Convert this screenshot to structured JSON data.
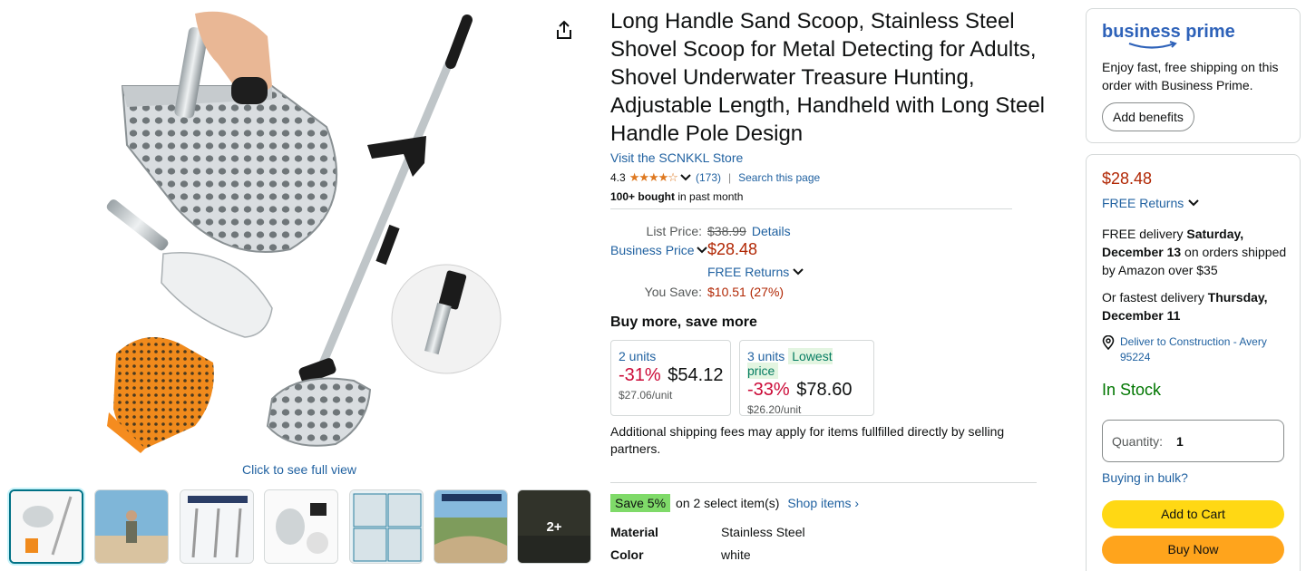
{
  "gallery": {
    "click_full_view": "Click to see full view",
    "more_count": "2+"
  },
  "product": {
    "title": "Long Handle Sand Scoop, Stainless Steel Shovel Scoop for Metal Detecting for Adults, Shovel Underwater Treasure Hunting, Adjustable Length, Handheld with Long Steel Handle Pole Design",
    "store_link": "Visit the SCNKKL Store",
    "rating": "4.3",
    "stars": "★★★★☆",
    "rating_count": "(173)",
    "search_page": "Search this page",
    "bought_bold": "100+ bought",
    "bought_rest": " in past month"
  },
  "pricing": {
    "list_label": "List Price:",
    "list_value": "$38.99",
    "details_link": "Details",
    "business_price_label": "Business Price",
    "business_price": "$28.48",
    "free_returns": "FREE Returns",
    "you_save_label": "You Save:",
    "you_save_value": "$10.51 (27%)"
  },
  "buy_more": {
    "heading": "Buy more, save more",
    "tiers": [
      {
        "units": "2 units",
        "badge": "",
        "discount": "-31%",
        "total": "$54.12",
        "per_unit": "$27.06/unit"
      },
      {
        "units": "3 units",
        "badge": "Lowest price",
        "discount": "-33%",
        "total": "$78.60",
        "per_unit": "$26.20/unit"
      }
    ]
  },
  "shipping_note": "Additional shipping fees may apply for items fullfilled directly by selling partners.",
  "promo": {
    "badge": "Save 5%",
    "text": "on 2 select item(s)",
    "link": "Shop items ›"
  },
  "specs": [
    {
      "key": "Material",
      "value": "Stainless Steel"
    },
    {
      "key": "Color",
      "value": "white"
    }
  ],
  "business_prime": {
    "logo_text": "business prime",
    "description": "Enjoy fast, free shipping on this order with Business Prime.",
    "button": "Add benefits"
  },
  "buy_box": {
    "price": "$28.48",
    "free_returns": "FREE Returns",
    "delivery_prefix": "FREE delivery ",
    "delivery_date": "Saturday, December 13",
    "delivery_suffix": " on orders shipped by Amazon over $35",
    "fastest_prefix": "Or fastest delivery ",
    "fastest_date": "Thursday, December 11",
    "deliver_to": "Deliver to Construction - Avery 95224",
    "stock": "In Stock",
    "quantity_label": "Quantity:",
    "quantity_value": "1",
    "bulk_link": "Buying in bulk?",
    "add_to_cart": "Add to Cart",
    "buy_now": "Buy Now"
  },
  "colors": {
    "link": "#2162a1",
    "price": "#b12704",
    "stock": "#007600",
    "add_to_cart": "#ffd814",
    "buy_now": "#ffa41c",
    "promo_badge": "#7fda69"
  }
}
